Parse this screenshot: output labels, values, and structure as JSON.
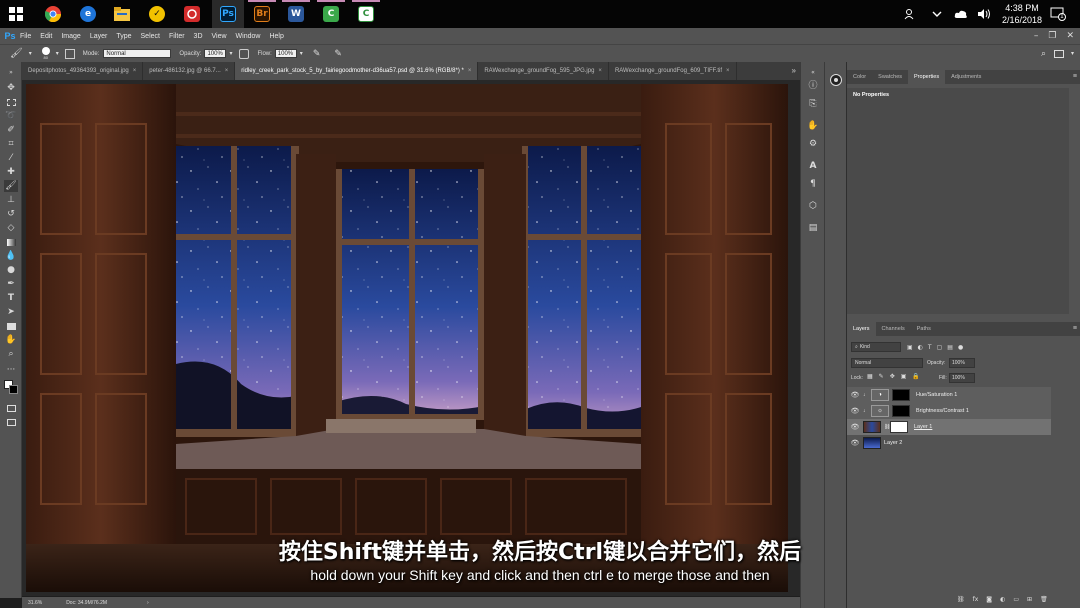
{
  "taskbar": {
    "apps": [
      {
        "name": "windows-start-icon",
        "label": "",
        "color": "#ffffff"
      },
      {
        "name": "chrome-icon",
        "label": "",
        "color": "#e94235"
      },
      {
        "name": "edge-icon",
        "label": "e",
        "color": "#1e74d8"
      },
      {
        "name": "file-explorer-icon",
        "label": "",
        "color": "#f5c542"
      },
      {
        "name": "norton-icon",
        "label": "✓",
        "color": "#f2c200"
      },
      {
        "name": "app-red-icon",
        "label": "",
        "color": "#d22b2b"
      },
      {
        "name": "photoshop-taskbar-icon",
        "label": "Ps",
        "color": "#31a8ff"
      },
      {
        "name": "bridge-taskbar-icon",
        "label": "Br",
        "color": "#e07d1a"
      },
      {
        "name": "word-taskbar-icon",
        "label": "W",
        "color": "#2b579a"
      },
      {
        "name": "camtasia-taskbar-icon",
        "label": "C",
        "color": "#3aa84a"
      },
      {
        "name": "camtasia-recorder-taskbar-icon",
        "label": "C",
        "color": "#2f8f3d"
      }
    ],
    "time": "4:38 PM",
    "date": "2/16/2018",
    "notification_count": "1"
  },
  "menubar": {
    "logo": "Ps",
    "items": [
      "File",
      "Edit",
      "Image",
      "Layer",
      "Type",
      "Select",
      "Filter",
      "3D",
      "View",
      "Window",
      "Help"
    ]
  },
  "options": {
    "brush_size": "80",
    "mode_label": "Mode:",
    "mode_value": "Normal",
    "opacity_label": "Opacity:",
    "opacity_value": "100%",
    "flow_label": "Flow:",
    "flow_value": "100%"
  },
  "tabs": [
    {
      "label": "Depositphotos_49364393_original.jpg",
      "active": false
    },
    {
      "label": "peter-486132.jpg @ 66.7...",
      "active": false
    },
    {
      "label": "ridley_creek_park_stock_5_by_fairiegoodmother-d36ua57.psd @ 31.6% (RGB/8*) *",
      "active": true
    },
    {
      "label": "RAWexchange_groundFog_595_JPG.jpg",
      "active": false
    },
    {
      "label": "RAWexchange_groundFog_609_TIFF.tif",
      "active": false
    }
  ],
  "status": {
    "zoom": "31.6%",
    "doc": "Doc: 34.9M/76.2M"
  },
  "properties": {
    "tabs": [
      "Color",
      "Swatches",
      "Properties",
      "Adjustments"
    ],
    "active_tab": "Properties",
    "body_label": "No Properties"
  },
  "layers": {
    "tabs": [
      "Layers",
      "Channels",
      "Paths"
    ],
    "kind_label": "Kind",
    "blend_mode": "Normal",
    "opacity_label": "Opacity:",
    "opacity_value": "100%",
    "lock_label": "Lock:",
    "fill_label": "Fill:",
    "fill_value": "100%",
    "items": [
      {
        "name": "Hue/Saturation 1",
        "type": "adjustment"
      },
      {
        "name": "Brightness/Contrast 1",
        "type": "adjustment"
      },
      {
        "name": "Layer 1",
        "type": "pixel"
      },
      {
        "name": "Layer 2",
        "type": "pixel"
      }
    ]
  },
  "subtitles": {
    "zh": "按住Shift键并单击，然后按Ctrl键以合并它们，然后",
    "en": "hold down your Shift key and click and then ctrl e to merge those and then"
  },
  "colors": {
    "ps_blue": "#31a8ff",
    "panel_bg": "#535353",
    "taskbar_bg": "#050505"
  }
}
